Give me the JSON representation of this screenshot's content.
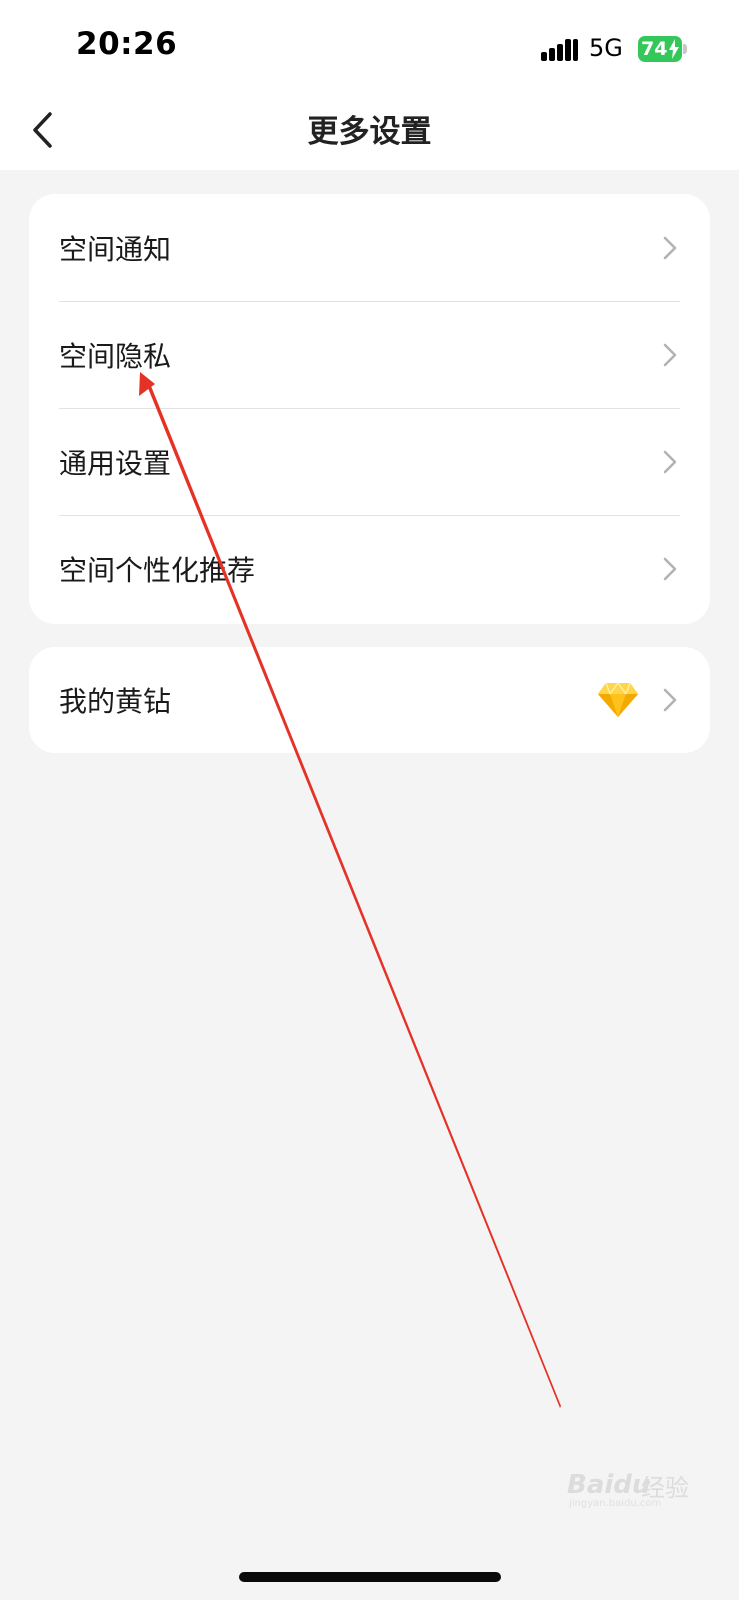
{
  "status_bar": {
    "time": "20:26",
    "network": "5G",
    "battery": "74"
  },
  "nav": {
    "title": "更多设置"
  },
  "settings_group": [
    {
      "label": "空间通知"
    },
    {
      "label": "空间隐私"
    },
    {
      "label": "通用设置"
    },
    {
      "label": "空间个性化推荐"
    }
  ],
  "membership": {
    "label": "我的黄钻"
  },
  "watermark": {
    "brand": "Baidu",
    "name": "经验",
    "site": "jingyan.baidu.com"
  },
  "colors": {
    "annotation_arrow": "#e53227",
    "battery": "#34c759",
    "diamond": "#f5b800"
  }
}
